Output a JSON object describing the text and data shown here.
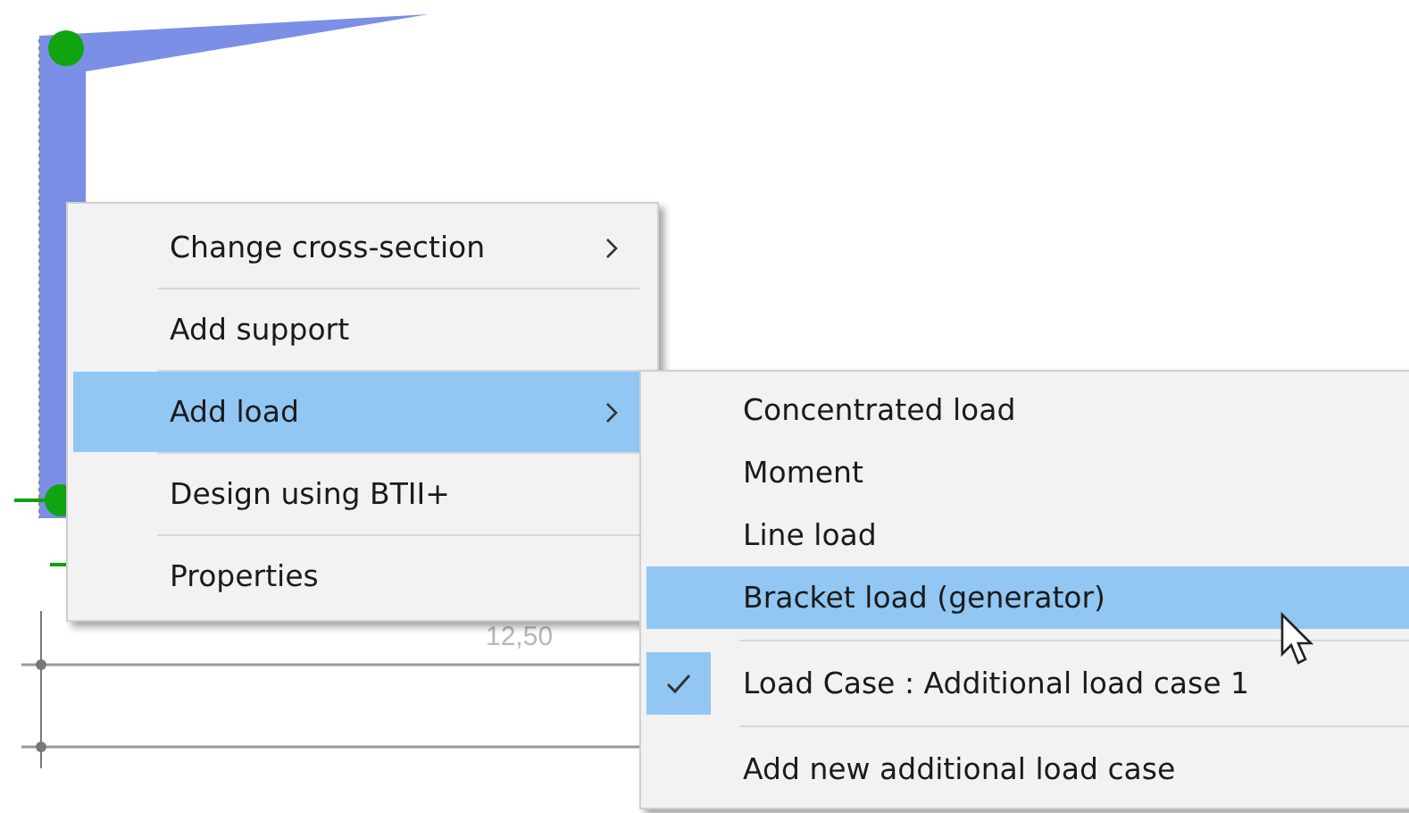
{
  "canvas": {
    "dimension_label": "12,50"
  },
  "context_menu": {
    "items": [
      {
        "label": "Change cross-section",
        "selected": false,
        "has_submenu": true
      },
      {
        "label": "Add support",
        "selected": false,
        "has_submenu": false
      },
      {
        "label": "Add load",
        "selected": true,
        "has_submenu": true
      },
      {
        "label": "Design using BTII+",
        "selected": false,
        "has_submenu": false
      },
      {
        "label": "Properties",
        "selected": false,
        "has_submenu": false
      }
    ]
  },
  "submenu": {
    "groups": [
      [
        {
          "label": "Concentrated load",
          "selected": false,
          "checked": false
        },
        {
          "label": "Moment",
          "selected": false,
          "checked": false
        },
        {
          "label": "Line load",
          "selected": false,
          "checked": false
        },
        {
          "label": "Bracket load (generator)",
          "selected": true,
          "checked": false
        }
      ],
      [
        {
          "label": "Load Case : Additional load case 1",
          "selected": false,
          "checked": true
        }
      ],
      [
        {
          "label": "Add new additional load case",
          "selected": false,
          "checked": false
        }
      ]
    ]
  }
}
